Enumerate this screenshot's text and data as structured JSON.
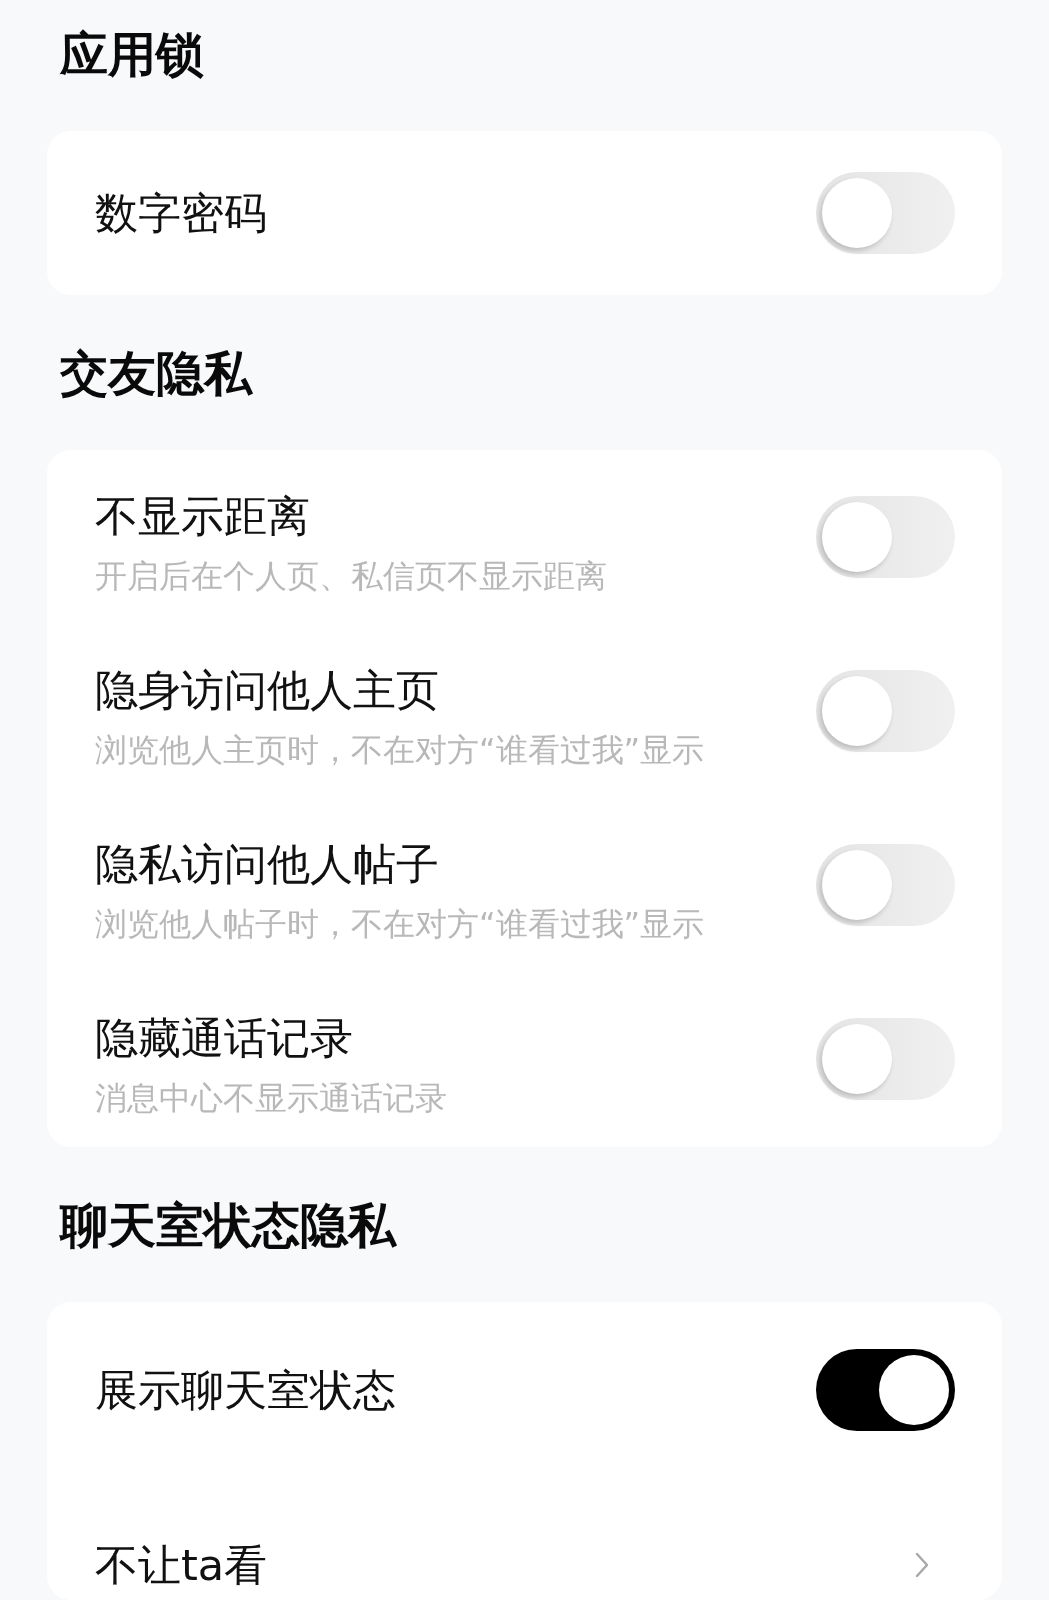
{
  "sections": [
    {
      "title": "应用锁",
      "items": [
        {
          "kind": "toggle",
          "label": "数字密码",
          "on": false
        }
      ]
    },
    {
      "title": "交友隐私",
      "items": [
        {
          "kind": "toggle",
          "label": "不显示距离",
          "description": "开启后在个人页、私信页不显示距离",
          "on": false
        },
        {
          "kind": "toggle",
          "label": "隐身访问他人主页",
          "description": "浏览他人主页时，不在对方“谁看过我”显示",
          "on": false
        },
        {
          "kind": "toggle",
          "label": "隐私访问他人帖子",
          "description": "浏览他人帖子时，不在对方“谁看过我”显示",
          "on": false
        },
        {
          "kind": "toggle",
          "label": "隐藏通话记录",
          "description": "消息中心不显示通话记录",
          "on": false
        }
      ]
    },
    {
      "title": "聊天室状态隐私",
      "items": [
        {
          "kind": "toggle",
          "label": "展示聊天室状态",
          "on": true
        },
        {
          "kind": "link",
          "label": "不让ta看"
        }
      ]
    }
  ]
}
